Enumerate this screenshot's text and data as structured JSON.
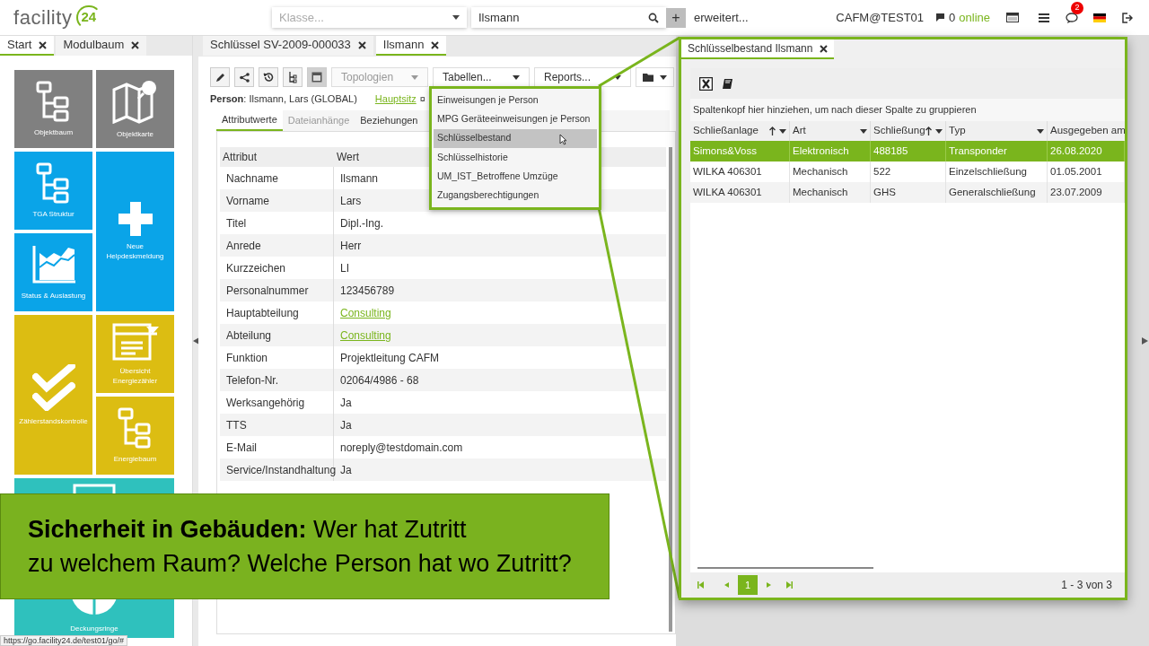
{
  "header": {
    "logo_text": "facility",
    "logo_number": "24",
    "class_select": {
      "placeholder": "Klasse..."
    },
    "search": {
      "value": "Ilsmann"
    },
    "add_button": "+",
    "advanced_link": "erweitert...",
    "user": "CAFM@TEST01",
    "online_count": "0",
    "online_label": "online",
    "notification_count": "2"
  },
  "left_panel": {
    "tabs": [
      {
        "label": "Start",
        "selected": true
      },
      {
        "label": "Modulbaum",
        "selected": false
      }
    ],
    "tiles": [
      {
        "label": "Objektbaum",
        "kind": "tree",
        "color": "#808080"
      },
      {
        "label": "Objektkarte",
        "kind": "map",
        "color": "#808080"
      },
      {
        "label": "TGA Struktur",
        "kind": "tree",
        "color": "#0aa4e8"
      },
      {
        "label": "Neue Helpdeskmeldung",
        "kind": "plus",
        "color": "#0aa4e8"
      },
      {
        "label": "Status & Auslastung",
        "kind": "chart",
        "color": "#0aa4e8"
      },
      {
        "label": "Zählerstandskontrolle",
        "kind": "check",
        "color": "#dcbd12"
      },
      {
        "label": "Übersicht Energiezähler",
        "kind": "form",
        "color": "#dcbd12"
      },
      {
        "label": "Energiebaum",
        "kind": "tree",
        "color": "#dcbd12"
      },
      {
        "label": "Deckungsringe",
        "kind": "rings",
        "color": "#2fc1bd"
      }
    ]
  },
  "main_panel": {
    "tabs": [
      {
        "label": "Schlüssel SV-2009-000033",
        "selected": false
      },
      {
        "label": "Ilsmann",
        "selected": true
      }
    ],
    "selects": [
      {
        "label": "Topologien",
        "disabled": true
      },
      {
        "label": "Tabellen...",
        "disabled": false
      },
      {
        "label": "Reports...",
        "disabled": false
      }
    ],
    "record": {
      "title": "**Person**: Ilsmann, Lars (GLOBAL)",
      "location_link": "Hauptsitz",
      "location_suffix": "¤"
    },
    "subtabs": [
      {
        "label": "Attributwerte",
        "selected": true,
        "disabled": false
      },
      {
        "label": "Dateianhänge",
        "selected": false,
        "disabled": true
      },
      {
        "label": "Beziehungen",
        "selected": false,
        "disabled": false
      }
    ],
    "table": {
      "columns": [
        "Attribut",
        "Wert"
      ],
      "rows": [
        {
          "attribute": "Nachname",
          "value": "Ilsmann",
          "kind": "text"
        },
        {
          "attribute": "Vorname",
          "value": "Lars",
          "kind": "text"
        },
        {
          "attribute": "Titel",
          "value": "Dipl.-Ing.",
          "kind": "text"
        },
        {
          "attribute": "Anrede",
          "value": "Herr",
          "kind": "text"
        },
        {
          "attribute": "Kurzzeichen",
          "value": "LI",
          "kind": "text"
        },
        {
          "attribute": "Personalnummer",
          "value": "123456789",
          "kind": "text"
        },
        {
          "attribute": "Hauptabteilung",
          "value": "Consulting",
          "kind": "link"
        },
        {
          "attribute": "Abteilung",
          "value": "Consulting",
          "kind": "link"
        },
        {
          "attribute": "Funktion",
          "value": "Projektleitung CAFM",
          "kind": "text"
        },
        {
          "attribute": "Telefon-Nr.",
          "value": "02064/4986 - 68",
          "kind": "text"
        },
        {
          "attribute": "Werksangehörig",
          "value": "Ja",
          "kind": "text"
        },
        {
          "attribute": "TTS",
          "value": "Ja",
          "kind": "text"
        },
        {
          "attribute": "E-Mail",
          "value": "noreply@testdomain.com",
          "kind": "text"
        },
        {
          "attribute": "Service/Instandhaltung",
          "value": "Ja",
          "kind": "text"
        }
      ]
    }
  },
  "tables_menu": {
    "items": [
      {
        "label": "Einweisungen je Person",
        "selected": false
      },
      {
        "label": "MPG Geräteeinweisungen je Person",
        "selected": false
      },
      {
        "label": "Schlüsselbestand",
        "selected": true
      },
      {
        "label": "Schlüsselhistorie",
        "selected": false
      },
      {
        "label": "UM_IST_Betroffene Umzüge",
        "selected": false
      },
      {
        "label": "Zugangsberechtigungen",
        "selected": false
      }
    ]
  },
  "callout": {
    "tab": {
      "label": "Schlüsselbestand Ilsmann",
      "selected": true
    },
    "group_hint": "Spaltenkopf hier hinziehen, um nach dieser Spalte zu gruppieren",
    "columns": [
      {
        "label": "Schließanlage",
        "sorted": true
      },
      {
        "label": "Art",
        "sorted": false
      },
      {
        "label": "Schließung",
        "sorted": true
      },
      {
        "label": "Typ",
        "sorted": false
      },
      {
        "label": "Ausgegeben am",
        "sorted": false
      }
    ],
    "rows": [
      {
        "cells": [
          "Simons&Voss",
          "Elektronisch",
          "488185",
          "Transponder",
          "26.08.2020"
        ],
        "selected": true
      },
      {
        "cells": [
          "WILKA 406301",
          "Mechanisch",
          "522",
          "Einzelschließung",
          "01.05.2001"
        ],
        "selected": false
      },
      {
        "cells": [
          "WILKA 406301",
          "Mechanisch",
          "GHS",
          "Generalschließung",
          "23.07.2009"
        ],
        "selected": false
      }
    ],
    "pager": {
      "current_page": "1",
      "summary": "1 - 3 von 3"
    }
  },
  "banner": {
    "lines": [
      "**Sicherheit in Gebäuden:** Wer hat Zutritt",
      "zu welchem Raum? Welche Person hat wo Zutritt?"
    ]
  },
  "status_bar": {
    "url": "https://go.facility24.de/test01/go/#"
  }
}
